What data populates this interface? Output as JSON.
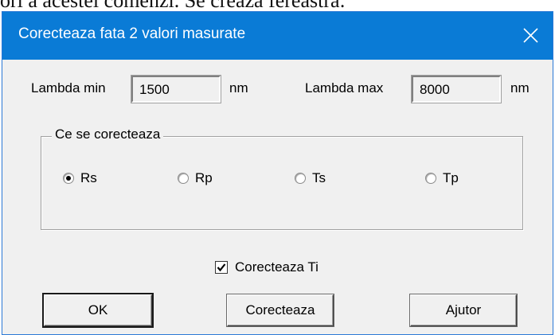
{
  "background_text": "ori a acestei comenzi.  Se creaza fereastra:",
  "dialog": {
    "title": "Corecteaza fata 2  valori masurate",
    "titlebar_color": "#0a7bd6",
    "close_icon": "close-icon"
  },
  "lambda": {
    "min_label": "Lambda min",
    "min_value": "1500",
    "min_unit": "nm",
    "max_label": "Lambda max",
    "max_value": "8000",
    "max_unit": "nm"
  },
  "group": {
    "legend": "Ce se corecteaza",
    "options": [
      {
        "label": "Rs",
        "selected": true
      },
      {
        "label": "Rp",
        "selected": false
      },
      {
        "label": "Ts",
        "selected": false
      },
      {
        "label": "Tp",
        "selected": false
      }
    ]
  },
  "checkbox": {
    "label": "Corecteaza Ti",
    "checked": true
  },
  "buttons": {
    "ok": "OK",
    "correct": "Corecteaza",
    "help": "Ajutor"
  }
}
